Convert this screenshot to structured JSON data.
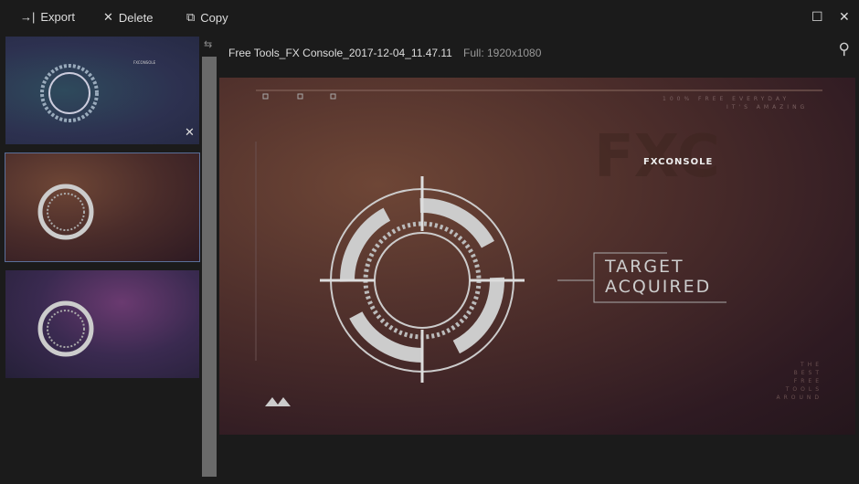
{
  "toolbar": {
    "export": "Export",
    "delete": "Delete",
    "copy": "Copy"
  },
  "viewer": {
    "filename": "Free Tools_FX Console_2017-12-04_11.47.11",
    "resolution": "Full: 1920x1080"
  },
  "artwork": {
    "brand": "FXCONSOLE",
    "watermark": "FXC",
    "title_line1": "TARGET",
    "title_line2": "ACQUIRED",
    "tagline1": "100% FREE EVERYDAY",
    "tagline2": "IT'S AMAZING",
    "side_text": [
      "THE",
      "BEST",
      "FREE",
      "TOOLS",
      "AROUND"
    ]
  },
  "thumbnails": [
    {
      "bg": "#2d3b5a",
      "selected": false
    },
    {
      "bg": "#4a2c2a",
      "selected": true
    },
    {
      "bg": "#3a2a50",
      "selected": false
    }
  ]
}
